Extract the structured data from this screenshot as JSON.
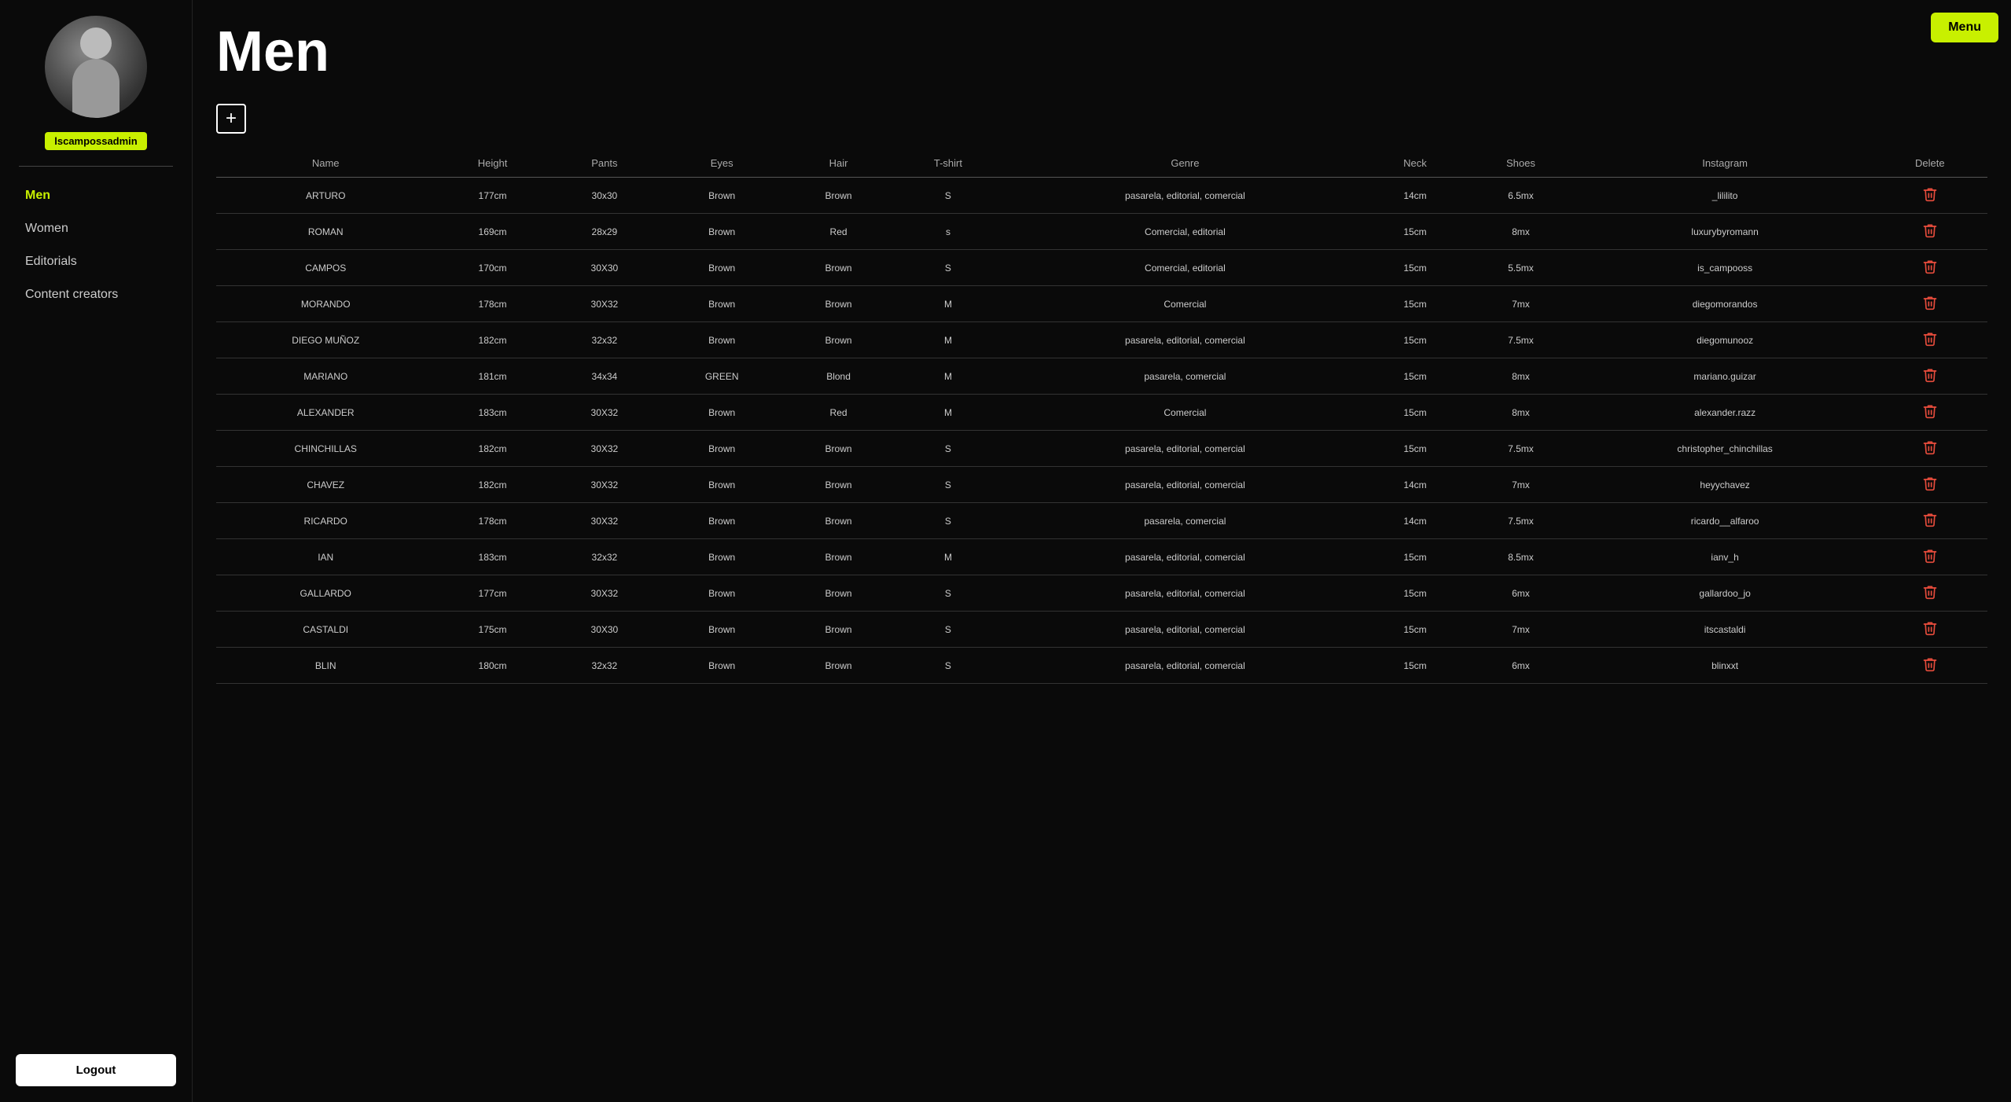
{
  "sidebar": {
    "username": "lscampossadmin",
    "nav_items": [
      {
        "label": "Men",
        "active": true,
        "id": "men"
      },
      {
        "label": "Women",
        "active": false,
        "id": "women"
      },
      {
        "label": "Editorials",
        "active": false,
        "id": "editorials"
      },
      {
        "label": "Content creators",
        "active": false,
        "id": "content-creators"
      }
    ],
    "logout_label": "Logout"
  },
  "header": {
    "title": "Men",
    "menu_label": "Menu",
    "add_icon": "+"
  },
  "table": {
    "columns": [
      "Name",
      "Height",
      "Pants",
      "Eyes",
      "Hair",
      "T-shirt",
      "Genre",
      "Neck",
      "Shoes",
      "Instagram",
      "Delete"
    ],
    "rows": [
      {
        "name": "ARTURO",
        "height": "177cm",
        "pants": "30x30",
        "eyes": "Brown",
        "hair": "Brown",
        "tshirt": "S",
        "genre": "pasarela, editorial, comercial",
        "neck": "14cm",
        "shoes": "6.5mx",
        "instagram": "_lililito"
      },
      {
        "name": "ROMAN",
        "height": "169cm",
        "pants": "28x29",
        "eyes": "Brown",
        "hair": "Red",
        "tshirt": "s",
        "genre": "Comercial, editorial",
        "neck": "15cm",
        "shoes": "8mx",
        "instagram": "luxurybyromann"
      },
      {
        "name": "CAMPOS",
        "height": "170cm",
        "pants": "30X30",
        "eyes": "Brown",
        "hair": "Brown",
        "tshirt": "S",
        "genre": "Comercial, editorial",
        "neck": "15cm",
        "shoes": "5.5mx",
        "instagram": "is_campooss"
      },
      {
        "name": "MORANDO",
        "height": "178cm",
        "pants": "30X32",
        "eyes": "Brown",
        "hair": "Brown",
        "tshirt": "M",
        "genre": "Comercial",
        "neck": "15cm",
        "shoes": "7mx",
        "instagram": "diegomorandos"
      },
      {
        "name": "DIEGO MUÑOZ",
        "height": "182cm",
        "pants": "32x32",
        "eyes": "Brown",
        "hair": "Brown",
        "tshirt": "M",
        "genre": "pasarela, editorial, comercial",
        "neck": "15cm",
        "shoes": "7.5mx",
        "instagram": "diegomunooz"
      },
      {
        "name": "MARIANO",
        "height": "181cm",
        "pants": "34x34",
        "eyes": "GREEN",
        "hair": "Blond",
        "tshirt": "M",
        "genre": "pasarela, comercial",
        "neck": "15cm",
        "shoes": "8mx",
        "instagram": "mariano.guizar"
      },
      {
        "name": "ALEXANDER",
        "height": "183cm",
        "pants": "30X32",
        "eyes": "Brown",
        "hair": "Red",
        "tshirt": "M",
        "genre": "Comercial",
        "neck": "15cm",
        "shoes": "8mx",
        "instagram": "alexander.razz"
      },
      {
        "name": "CHINCHILLAS",
        "height": "182cm",
        "pants": "30X32",
        "eyes": "Brown",
        "hair": "Brown",
        "tshirt": "S",
        "genre": "pasarela, editorial, comercial",
        "neck": "15cm",
        "shoes": "7.5mx",
        "instagram": "christopher_chinchillas"
      },
      {
        "name": "CHAVEZ",
        "height": "182cm",
        "pants": "30X32",
        "eyes": "Brown",
        "hair": "Brown",
        "tshirt": "S",
        "genre": "pasarela, editorial, comercial",
        "neck": "14cm",
        "shoes": "7mx",
        "instagram": "heyychavez"
      },
      {
        "name": "RICARDO",
        "height": "178cm",
        "pants": "30X32",
        "eyes": "Brown",
        "hair": "Brown",
        "tshirt": "S",
        "genre": "pasarela, comercial",
        "neck": "14cm",
        "shoes": "7.5mx",
        "instagram": "ricardo__alfaroo"
      },
      {
        "name": "IAN",
        "height": "183cm",
        "pants": "32x32",
        "eyes": "Brown",
        "hair": "Brown",
        "tshirt": "M",
        "genre": "pasarela, editorial, comercial",
        "neck": "15cm",
        "shoes": "8.5mx",
        "instagram": "ianv_h"
      },
      {
        "name": "GALLARDO",
        "height": "177cm",
        "pants": "30X32",
        "eyes": "Brown",
        "hair": "Brown",
        "tshirt": "S",
        "genre": "pasarela, editorial, comercial",
        "neck": "15cm",
        "shoes": "6mx",
        "instagram": "gallardoo_jo"
      },
      {
        "name": "CASTALDI",
        "height": "175cm",
        "pants": "30X30",
        "eyes": "Brown",
        "hair": "Brown",
        "tshirt": "S",
        "genre": "pasarela, editorial, comercial",
        "neck": "15cm",
        "shoes": "7mx",
        "instagram": "itscastaldi"
      },
      {
        "name": "BLIN",
        "height": "180cm",
        "pants": "32x32",
        "eyes": "Brown",
        "hair": "Brown",
        "tshirt": "S",
        "genre": "pasarela, editorial, comercial",
        "neck": "15cm",
        "shoes": "6mx",
        "instagram": "blinxxt"
      }
    ]
  }
}
